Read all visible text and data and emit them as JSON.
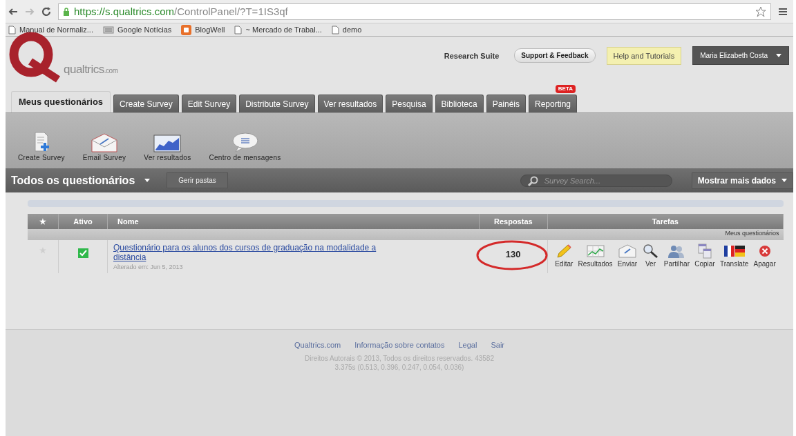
{
  "browser": {
    "url_host": "https://s.qualtrics.com",
    "url_path": "/ControlPanel/?T=1IS3qf",
    "bookmarks": [
      {
        "label": "Manual de Normaliz...",
        "kind": "page"
      },
      {
        "label": "Google Notícias",
        "kind": "news"
      },
      {
        "label": "BlogWell",
        "kind": "blogger"
      },
      {
        "label": "~ Mercado de Trabal...",
        "kind": "page"
      },
      {
        "label": "demo",
        "kind": "page"
      }
    ]
  },
  "header": {
    "logo_text": "qualtrics",
    "logo_suffix": ".com",
    "suite": "Research Suite",
    "support": "Support & Feedback",
    "help": "Help and Tutorials",
    "user": "Maria Elizabeth Costa"
  },
  "tabs": [
    {
      "label": "Meus questionários",
      "selected": true
    },
    {
      "label": "Create Survey",
      "selected": false
    },
    {
      "label": "Edit Survey",
      "selected": false
    },
    {
      "label": "Distribute Survey",
      "selected": false
    },
    {
      "label": "Ver resultados",
      "selected": false
    },
    {
      "label": "Pesquisa",
      "selected": false
    },
    {
      "label": "Biblioteca",
      "selected": false
    },
    {
      "label": "Painéis",
      "selected": false
    },
    {
      "label": "Reporting",
      "selected": false,
      "badge": "BETA"
    }
  ],
  "toolbar": [
    {
      "label": "Create Survey",
      "kind": "create"
    },
    {
      "label": "Email Survey",
      "kind": "email"
    },
    {
      "label": "Ver resultados",
      "kind": "chart"
    },
    {
      "label": "Centro de mensagens",
      "kind": "message"
    }
  ],
  "listbar": {
    "title": "Todos os questionários",
    "manage": "Gerir pastas",
    "search_placeholder": "Survey Search...",
    "more": "Mostrar mais dados"
  },
  "table": {
    "columns": {
      "star": "★",
      "active": "Ativo",
      "name": "Nome",
      "responses": "Respostas",
      "tasks": "Tarefas"
    },
    "group": "Meus questionários",
    "rows": [
      {
        "starred": false,
        "active": true,
        "name": "Questionário para os alunos dos cursos de graduação na modalidade a distância",
        "modified": "Alterado em: Jun 5, 2013",
        "responses": "130",
        "circled": true,
        "tasks": [
          {
            "label": "Editar",
            "kind": "edit"
          },
          {
            "label": "Resultados",
            "kind": "results"
          },
          {
            "label": "Enviar",
            "kind": "send"
          },
          {
            "label": "Ver",
            "kind": "view"
          },
          {
            "label": "Partilhar",
            "kind": "share"
          },
          {
            "label": "Copiar",
            "kind": "copy"
          },
          {
            "label": "Translate",
            "kind": "translate"
          },
          {
            "label": "Apagar",
            "kind": "delete"
          }
        ]
      }
    ]
  },
  "footer": {
    "links": [
      "Qualtrics.com",
      "Informação sobre contatos",
      "Legal",
      "Sair"
    ],
    "copyright": "Direitos Autorais © 2013, Todos os direitos reservados. 43582",
    "timing": "3.375s (0.513, 0.396, 0.247, 0.054, 0.036)"
  }
}
